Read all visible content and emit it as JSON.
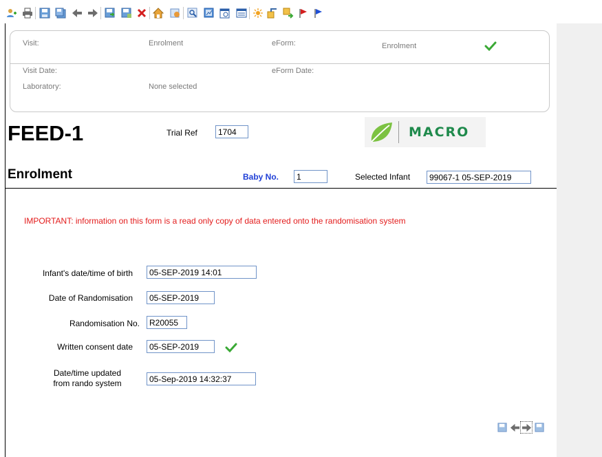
{
  "toolbar": {
    "icons": [
      "add-user-icon",
      "print-icon",
      "save-icon",
      "save-all-icon",
      "back-arrow-icon",
      "forward-arrow-icon",
      "save-next-icon",
      "save-close-icon",
      "delete-icon",
      "home-icon",
      "search-subject-icon",
      "find-icon",
      "report-icon",
      "calendar-icon",
      "list-icon",
      "sun-icon",
      "export-icon",
      "import-icon",
      "red-flag-icon",
      "blue-flag-icon"
    ]
  },
  "header": {
    "visit_label": "Visit:",
    "visit_value": "Enrolment",
    "eform_label": "eForm:",
    "eform_value": "Enrolment",
    "visit_date_label": "Visit Date:",
    "eform_date_label": "eForm Date:",
    "laboratory_label": "Laboratory:",
    "laboratory_value": "None selected"
  },
  "study": {
    "title": "FEED-1",
    "trial_ref_label": "Trial Ref",
    "trial_ref_value": "1704",
    "logo_text": "MACRO"
  },
  "form": {
    "title": "Enrolment",
    "baby_no_label": "Baby No.",
    "baby_no_value": "1",
    "selected_infant_label": "Selected Infant",
    "selected_infant_value": "99067-1 05-SEP-2019",
    "important": "IMPORTANT: information on this form is a read only copy of data entered onto the randomisation system",
    "fields": {
      "birth_label": "Infant's date/time of birth",
      "birth_value": "05-SEP-2019 14:01",
      "rand_date_label": "Date of Randomisation",
      "rand_date_value": "05-SEP-2019",
      "rand_no_label": "Randomisation No.",
      "rand_no_value": "R20055",
      "consent_label": "Written consent date",
      "consent_value": "05-SEP-2019",
      "updated_label_line1": "Date/time updated",
      "updated_label_line2": "from rando system",
      "updated_value": "05-Sep-2019 14:32:37"
    }
  },
  "colors": {
    "accent_blue": "#1f3fd6",
    "important_red": "#e31b1b",
    "check_green": "#3aa935",
    "field_border": "#6f93c8"
  }
}
